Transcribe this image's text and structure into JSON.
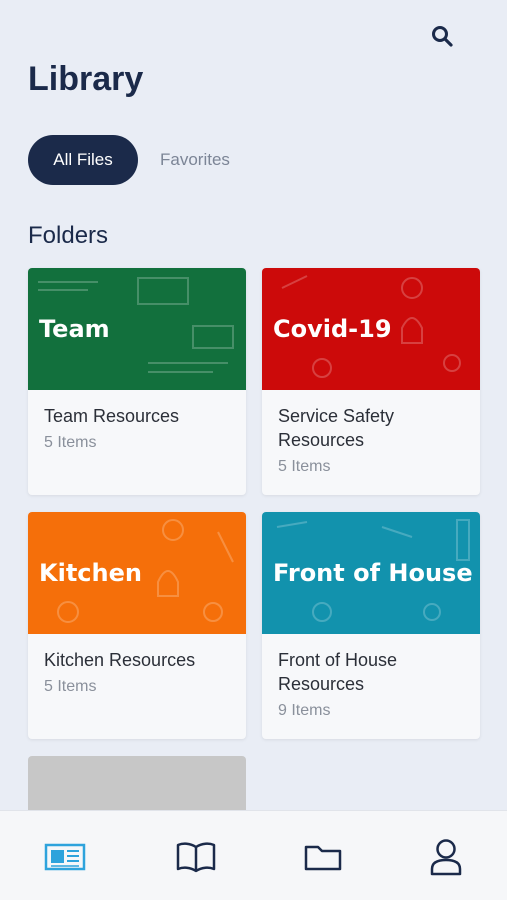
{
  "header": {
    "title": "Library",
    "search_icon": "search-icon"
  },
  "tabs": [
    {
      "label": "All Files",
      "active": true
    },
    {
      "label": "Favorites",
      "active": false
    }
  ],
  "folders_section": {
    "title": "Folders"
  },
  "folders": [
    {
      "banner": "Team",
      "name": "Team Resources",
      "count": "5 Items",
      "color": "#12703d"
    },
    {
      "banner": "Covid-19",
      "name": "Service Safety Resources",
      "count": "5 Items",
      "color": "#cc0a0a"
    },
    {
      "banner": "Kitchen",
      "name": "Kitchen Resources",
      "count": "5 Items",
      "color": "#f56f0a"
    },
    {
      "banner": "Front of House",
      "name": "Front of House Resources",
      "count": "9 Items",
      "color": "#1292ad"
    }
  ],
  "partial_folder": {
    "color": "#c7c7c7"
  },
  "bottom_nav": {
    "items": [
      {
        "icon": "news-icon",
        "active": true,
        "color": "#2ea3dc"
      },
      {
        "icon": "book-icon",
        "active": false,
        "color": "#1b2a4a"
      },
      {
        "icon": "folder-icon",
        "active": false,
        "color": "#1b2a4a"
      },
      {
        "icon": "profile-icon",
        "active": false,
        "color": "#1b2a4a"
      }
    ]
  }
}
